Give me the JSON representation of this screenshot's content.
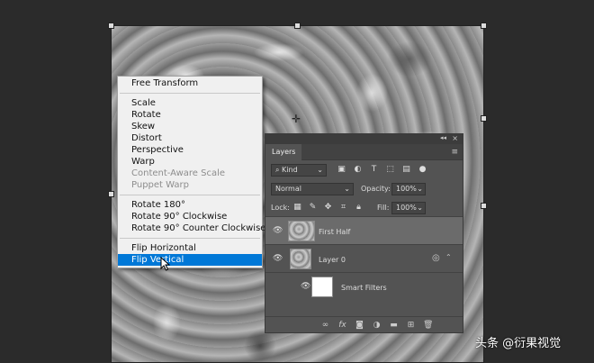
{
  "context_menu": {
    "items": [
      {
        "label": "Free Transform",
        "disabled": false
      },
      {
        "separator": true
      },
      {
        "label": "Scale",
        "disabled": false
      },
      {
        "label": "Rotate",
        "disabled": false
      },
      {
        "label": "Skew",
        "disabled": false
      },
      {
        "label": "Distort",
        "disabled": false
      },
      {
        "label": "Perspective",
        "disabled": false
      },
      {
        "label": "Warp",
        "disabled": false
      },
      {
        "label": "Content-Aware Scale",
        "disabled": true
      },
      {
        "label": "Puppet Warp",
        "disabled": true
      },
      {
        "separator": true
      },
      {
        "label": "Rotate 180°",
        "disabled": false
      },
      {
        "label": "Rotate 90° Clockwise",
        "disabled": false
      },
      {
        "label": "Rotate 90° Counter Clockwise",
        "disabled": false
      },
      {
        "separator": true
      },
      {
        "label": "Flip Horizontal",
        "disabled": false
      },
      {
        "label": "Flip Vertical",
        "disabled": false,
        "selected": true
      }
    ]
  },
  "layers_panel": {
    "tab_label": "Layers",
    "collapse_glyph": "◂◂",
    "close_glyph": "×",
    "filter_kind": "Kind",
    "blend_mode": "Normal",
    "opacity_label": "Opacity:",
    "opacity_value": "100%",
    "lock_label": "Lock:",
    "fill_label": "Fill:",
    "fill_value": "100%",
    "layers": [
      {
        "name": "First Half",
        "active": true
      },
      {
        "name": "Layer 0",
        "active": false
      },
      {
        "name": "Smart Filters",
        "active": false
      }
    ]
  },
  "watermark": "头条 @衍果视觉"
}
